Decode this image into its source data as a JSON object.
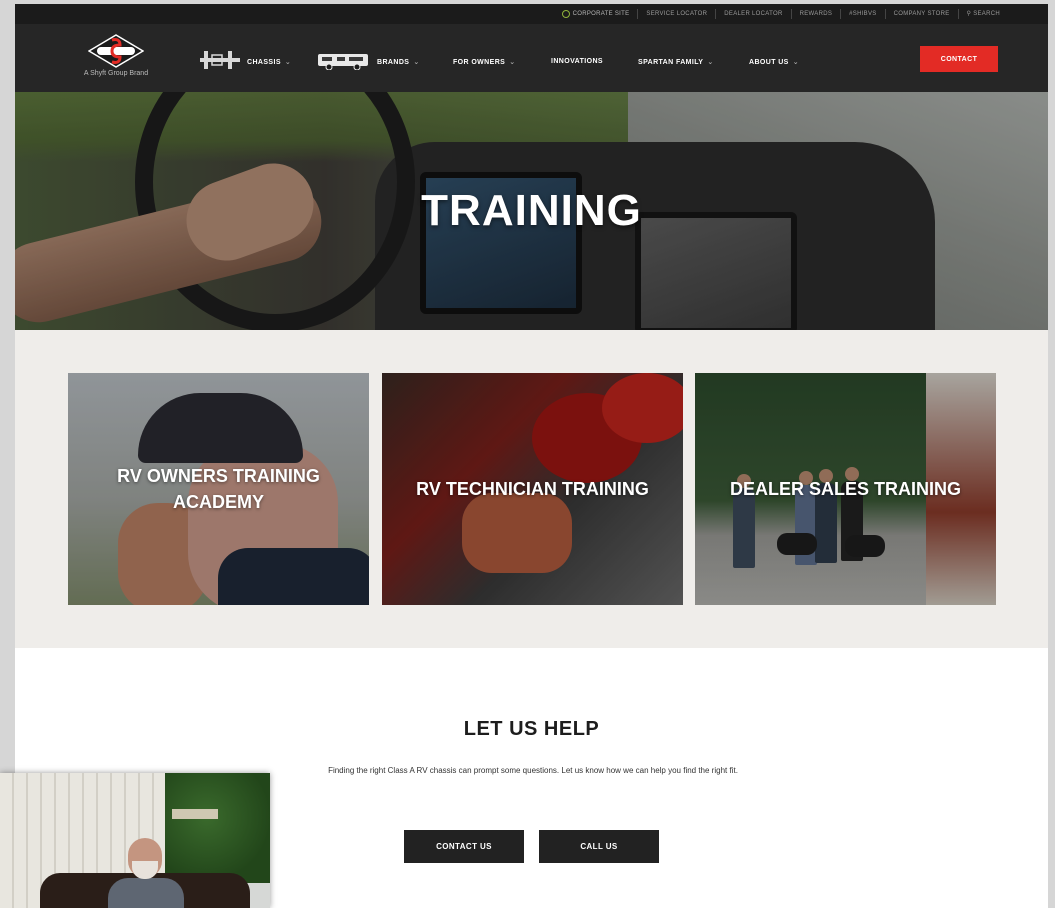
{
  "utility_nav": {
    "items": [
      {
        "label": "CORPORATE SITE",
        "icon": "globe-icon"
      },
      {
        "label": "SERVICE LOCATOR"
      },
      {
        "label": "DEALER LOCATOR"
      },
      {
        "label": "REWARDS"
      },
      {
        "label": "#SHIBVS"
      },
      {
        "label": "COMPANY STORE"
      },
      {
        "label": "SEARCH",
        "icon": "search-icon"
      }
    ]
  },
  "brand": {
    "badge_text": "SPARTAN",
    "tagline": "A Shyft Group Brand"
  },
  "main_nav": {
    "chassis": "CHASSIS",
    "brands": "BRANDS",
    "for_owners": "FOR OWNERS",
    "innovations": "INNOVATIONS",
    "spartan_family": "SPARTAN FAMILY",
    "about_us": "ABOUT US",
    "contact": "CONTACT"
  },
  "hero": {
    "title": "TRAINING"
  },
  "training_cards": [
    {
      "title": "RV OWNERS TRAINING ACADEMY"
    },
    {
      "title": "RV TECHNICIAN TRAINING"
    },
    {
      "title": "DEALER SALES TRAINING"
    }
  ],
  "help": {
    "title": "LET US HELP",
    "text": "Finding the right Class A RV chassis can prompt some questions. Let us know how we can help you find the right fit.",
    "contact_button": "CONTACT US",
    "call_button": "CALL US"
  },
  "colors": {
    "accent_red": "#e32b25",
    "nav_dark": "#262626",
    "utility_dark": "#1b1b1b",
    "section_beige": "#efedea",
    "button_dark": "#222222"
  }
}
